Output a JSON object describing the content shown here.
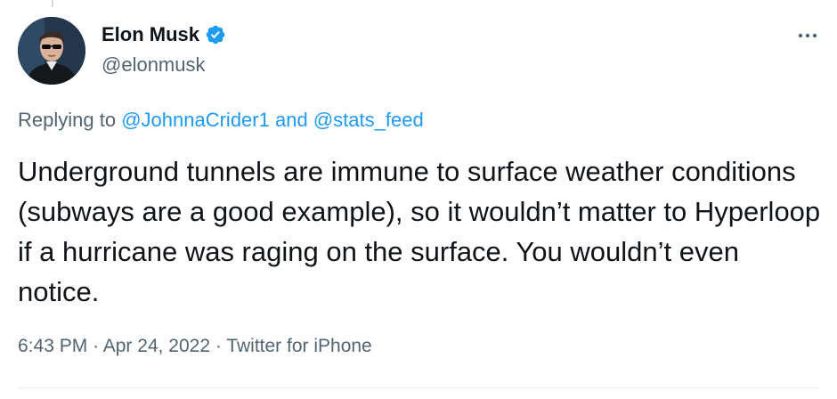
{
  "author": {
    "display_name": "Elon Musk",
    "handle": "@elonmusk",
    "verified": true
  },
  "replying": {
    "prefix": "Replying to",
    "mention_1": "@JohnnaCrider1",
    "conjunction": "and",
    "mention_2": "@stats_feed"
  },
  "tweet": {
    "text": "Underground tunnels are immune to surface weather conditions (subways are a good example), so it wouldn’t matter to Hyperloop if a hurricane was raging on the surface. You wouldn’t even notice."
  },
  "meta": {
    "time": "6:43 PM",
    "separator": "·",
    "date": "Apr 24, 2022",
    "source": "Twitter for iPhone"
  },
  "icons": {
    "more": "more-horizontal-icon",
    "verified": "verified-badge-icon"
  },
  "colors": {
    "accent": "#1d9bf0",
    "text": "#0f1419",
    "secondary": "#536471",
    "divider": "#eff3f4"
  }
}
